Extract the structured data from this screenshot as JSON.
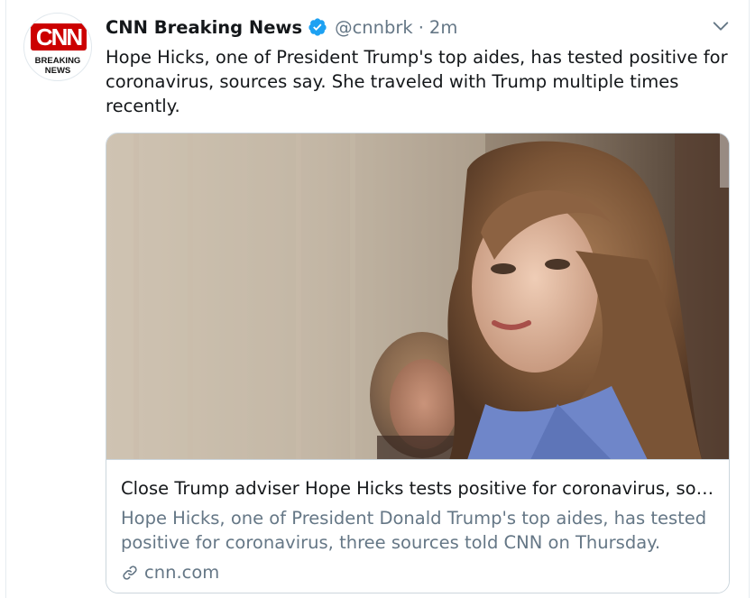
{
  "tweet": {
    "avatar": {
      "logo_text": "CNN",
      "tag_line1": "BREAKING",
      "tag_line2": "NEWS"
    },
    "author_name": "CNN Breaking News",
    "verified": true,
    "handle": "@cnnbrk",
    "separator": "·",
    "timestamp": "2m",
    "text": "Hope Hicks, one of President Trump's top aides, has tested positive for coronavirus, sources say. She traveled with Trump multiple times recently.",
    "menu_icon": "chevron-down-icon"
  },
  "card": {
    "image_description_icon": "news-photo",
    "title": "Close Trump adviser Hope Hicks tests positive for coronavirus, sou...",
    "description": "Hope Hicks, one of President Donald Trump's top aides, has tested positive for coronavirus, three sources told CNN on Thursday.",
    "domain": "cnn.com",
    "link_icon": "link-icon"
  },
  "colors": {
    "text_primary": "#14171a",
    "text_secondary": "#657786",
    "verified_blue": "#1da1f2",
    "cnn_red": "#cc0000",
    "border": "#ccd6dd"
  }
}
